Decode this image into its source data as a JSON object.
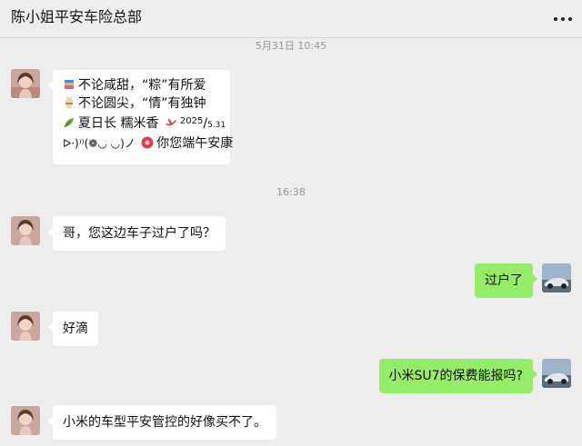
{
  "header": {
    "title": "陈小姐平安车险总部",
    "more_icon": "more-dots-icon"
  },
  "timestamps": [
    "5月31日 10:45",
    "16:38"
  ],
  "messages": [
    {
      "side": "left",
      "lines": [
        {
          "icon": "milk-tea-icon",
          "text": "不论咸甜，“粽”有所爱"
        },
        {
          "icon": "cup-icon",
          "text": "不论圆尖，“情”有独钟"
        },
        {
          "icon": "leaf-icon",
          "text": "夏日长 糯米香",
          "icon2": "dragon-boat-icon",
          "sup": "2025",
          "slash": "/",
          "sub": "5.31"
        },
        {
          "prefix": "ᐅ·)⁾⁾(❁◡ ◡)ノ",
          "icon": "flower-icon",
          "text": "你您端午安康"
        }
      ]
    },
    {
      "side": "left",
      "text": "哥，您这边车子过户了吗？"
    },
    {
      "side": "right",
      "text": "过户了"
    },
    {
      "side": "left",
      "text": "好滴"
    },
    {
      "side": "right",
      "text": "小米SU7的保费能报吗?"
    },
    {
      "side": "left",
      "text": "小米的车型平安管控的好像买不了。"
    }
  ],
  "colors": {
    "background": "#ededed",
    "bubble_self": "#95ec69",
    "bubble_other": "#ffffff",
    "timestamp": "#9a9a9a"
  }
}
